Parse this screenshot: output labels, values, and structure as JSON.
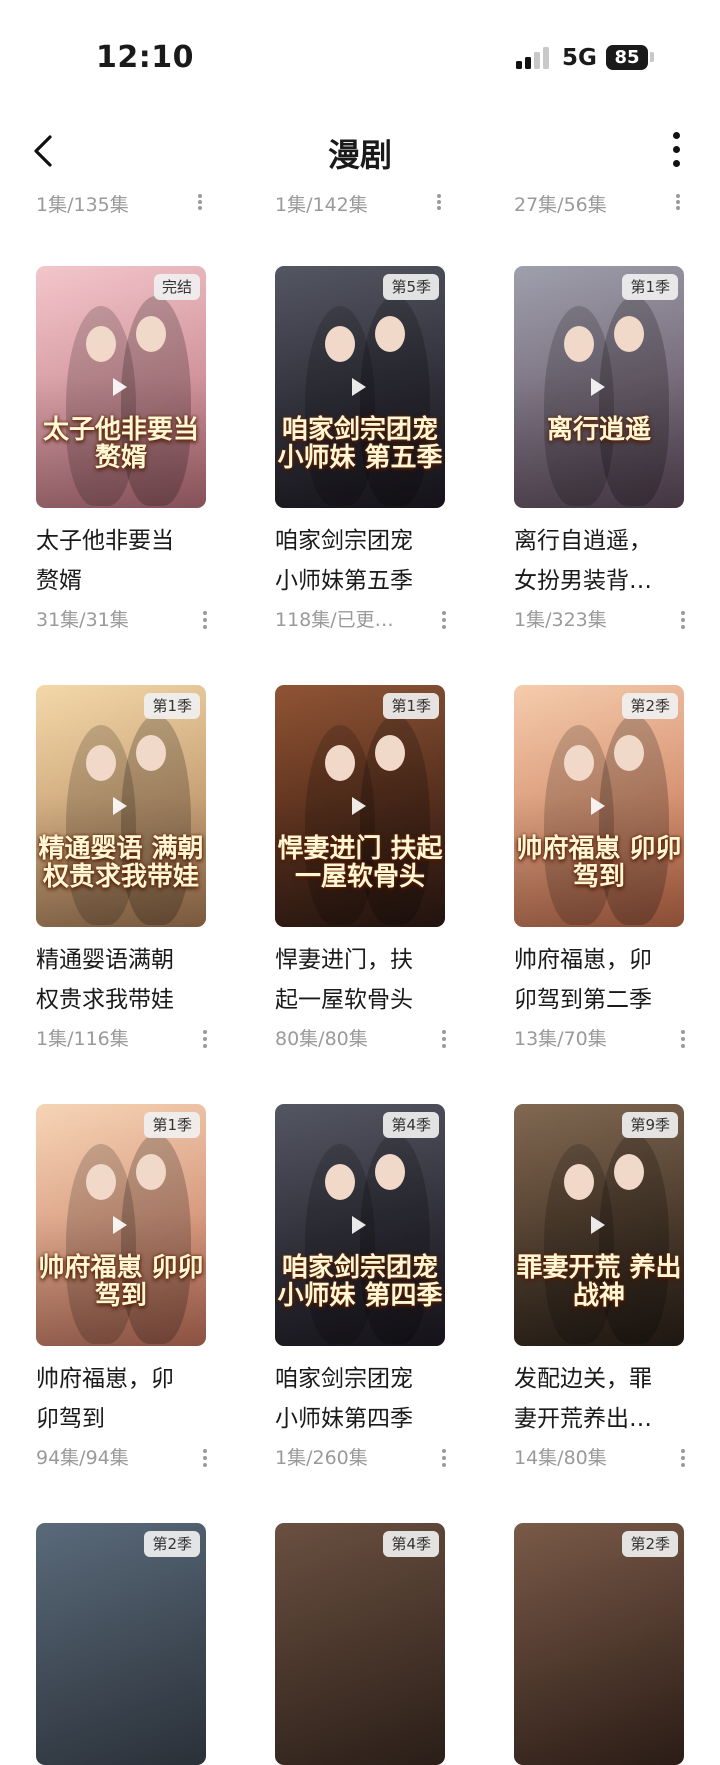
{
  "status": {
    "time": "12:10",
    "network": "5G",
    "battery": "85"
  },
  "nav": {
    "title": "漫剧"
  },
  "top_row": [
    {
      "episodes": "1集/135集"
    },
    {
      "episodes": "1集/142集"
    },
    {
      "episodes": "27集/56集"
    }
  ],
  "items": [
    {
      "badge": "完结",
      "poster_text": "太子他非要当赘婿",
      "title_l1": "太子他非要当",
      "title_l2": "赘婿",
      "episodes": "31集/31集",
      "colors": [
        "#f2c3c8",
        "#b8707a"
      ]
    },
    {
      "badge": "第5季",
      "poster_text": "咱家剑宗团宠小师妹 第五季",
      "title_l1": "咱家剑宗团宠",
      "title_l2": "小师妹第五季",
      "episodes": "118集/已更…",
      "colors": [
        "#4b4d5a",
        "#1d1a22"
      ]
    },
    {
      "badge": "第1季",
      "poster_text": "离行逍遥",
      "title_l1": "离行自逍遥，",
      "title_l2": "女扮男装背…",
      "episodes": "1集/323集",
      "colors": [
        "#9a9aa8",
        "#5e4a5a"
      ]
    },
    {
      "badge": "第1季",
      "poster_text": "精通婴语 满朝权贵求我带娃",
      "title_l1": "精通婴语满朝",
      "title_l2": "权贵求我带娃",
      "episodes": "1集/116集",
      "colors": [
        "#f3d6a4",
        "#a87a55"
      ]
    },
    {
      "badge": "第1季",
      "poster_text": "悍妻进门 扶起一屋软骨头",
      "title_l1": "悍妻进门，扶",
      "title_l2": "起一屋软骨头",
      "episodes": "80集/80集",
      "colors": [
        "#8a4b2a",
        "#2e1a14"
      ]
    },
    {
      "badge": "第2季",
      "poster_text": "帅府福崽 卯卯驾到",
      "title_l1": "帅府福崽，卯",
      "title_l2": "卯驾到第二季",
      "episodes": "13集/70集",
      "colors": [
        "#f4c9a8",
        "#c06a4a"
      ]
    },
    {
      "badge": "第1季",
      "poster_text": "帅府福崽 卯卯驾到",
      "title_l1": "帅府福崽，卯",
      "title_l2": "卯驾到",
      "episodes": "94集/94集",
      "colors": [
        "#f6d2b2",
        "#c0705a"
      ]
    },
    {
      "badge": "第4季",
      "poster_text": "咱家剑宗团宠小师妹 第四季",
      "title_l1": "咱家剑宗团宠",
      "title_l2": "小师妹第四季",
      "episodes": "1集/260集",
      "colors": [
        "#4b4d5a",
        "#1d1a22"
      ]
    },
    {
      "badge": "第9季",
      "poster_text": "罪妻开荒 养出战神",
      "title_l1": "发配边关，罪",
      "title_l2": "妻开荒养出…",
      "episodes": "14集/80集",
      "colors": [
        "#7a6048",
        "#2a2018"
      ]
    }
  ],
  "bottom_row": [
    {
      "badge": "第2季",
      "colors": [
        "#5a6a7a",
        "#2a3038"
      ]
    },
    {
      "badge": "第4季",
      "colors": [
        "#6a5040",
        "#2a1e18"
      ]
    },
    {
      "badge": "第2季",
      "colors": [
        "#7a5a48",
        "#2a1c16"
      ]
    }
  ]
}
